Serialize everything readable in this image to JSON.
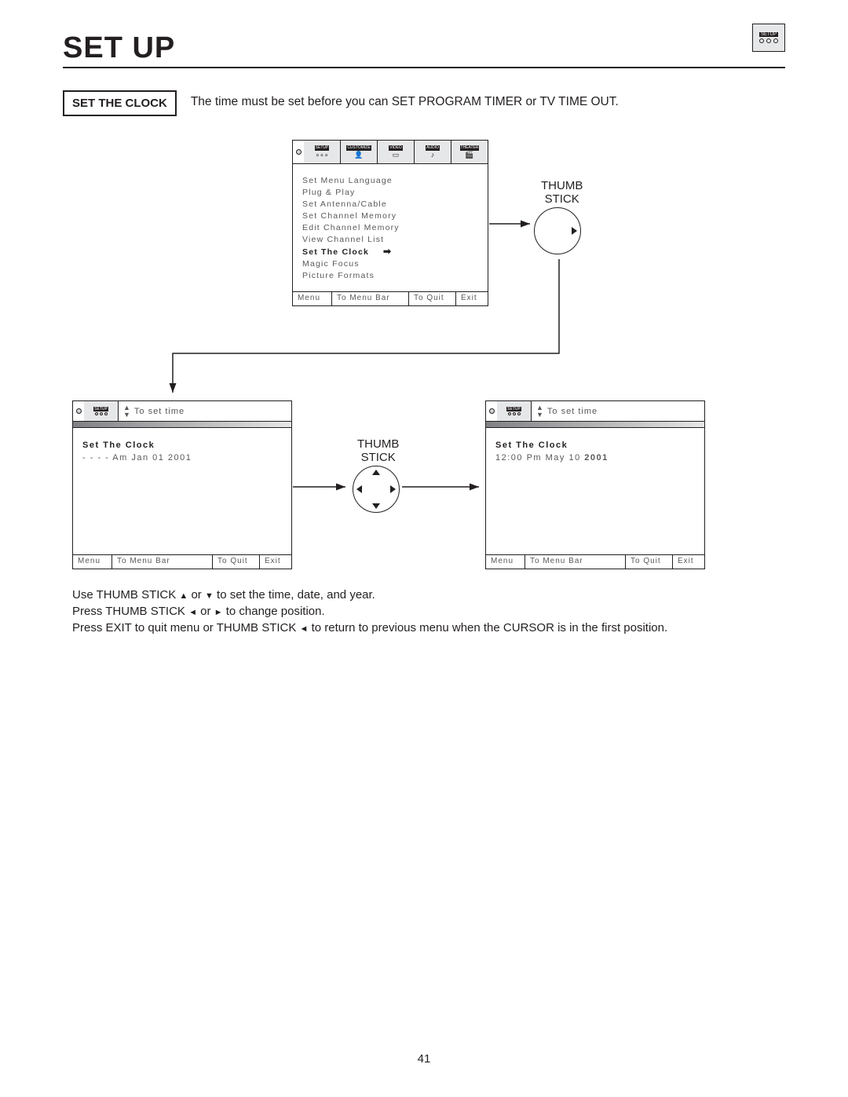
{
  "page": {
    "title": "Set Up",
    "number": "41"
  },
  "corner_icon": {
    "label": "SETUP"
  },
  "intro": {
    "heading": "SET THE CLOCK",
    "text": "The time must be set before you can  SET PROGRAM TIMER or TV TIME OUT."
  },
  "menubar_tabs": [
    "SETUP",
    "CUSTOMIZE",
    "VIDEO",
    "AUDIO",
    "THEATER"
  ],
  "main_menu": {
    "items": [
      "Set Menu Language",
      "Plug & Play",
      "Set Antenna/Cable",
      "Set Channel Memory",
      "Edit Channel Memory",
      "View Channel List",
      "Set The Clock",
      "Magic Focus",
      "Picture Formats"
    ],
    "selected_index": 6
  },
  "footer": {
    "c1": "Menu",
    "c2": "To Menu Bar",
    "c3": "To Quit",
    "c4": "Exit"
  },
  "thumb": {
    "label": "THUMB\nSTICK"
  },
  "small_bar": {
    "label": "SETUP",
    "hint": "To set time"
  },
  "clock_left": {
    "heading": "Set The Clock",
    "value_pre": "- -  - - Am Jan 01 2001"
  },
  "clock_right": {
    "heading": "Set The Clock",
    "value_pre": "12:00 Pm May 10 ",
    "value_bold": "2001"
  },
  "instructions": {
    "l1a": "Use THUMB STICK ",
    "l1b": " or ",
    "l1c": " to set the time, date, and year.",
    "l2a": "Press THUMB STICK ",
    "l2b": " or ",
    "l2c": " to change position.",
    "l3a": "Press EXIT to quit menu or THUMB STICK ",
    "l3b": " to return to previous menu when the CURSOR is in the first position."
  }
}
